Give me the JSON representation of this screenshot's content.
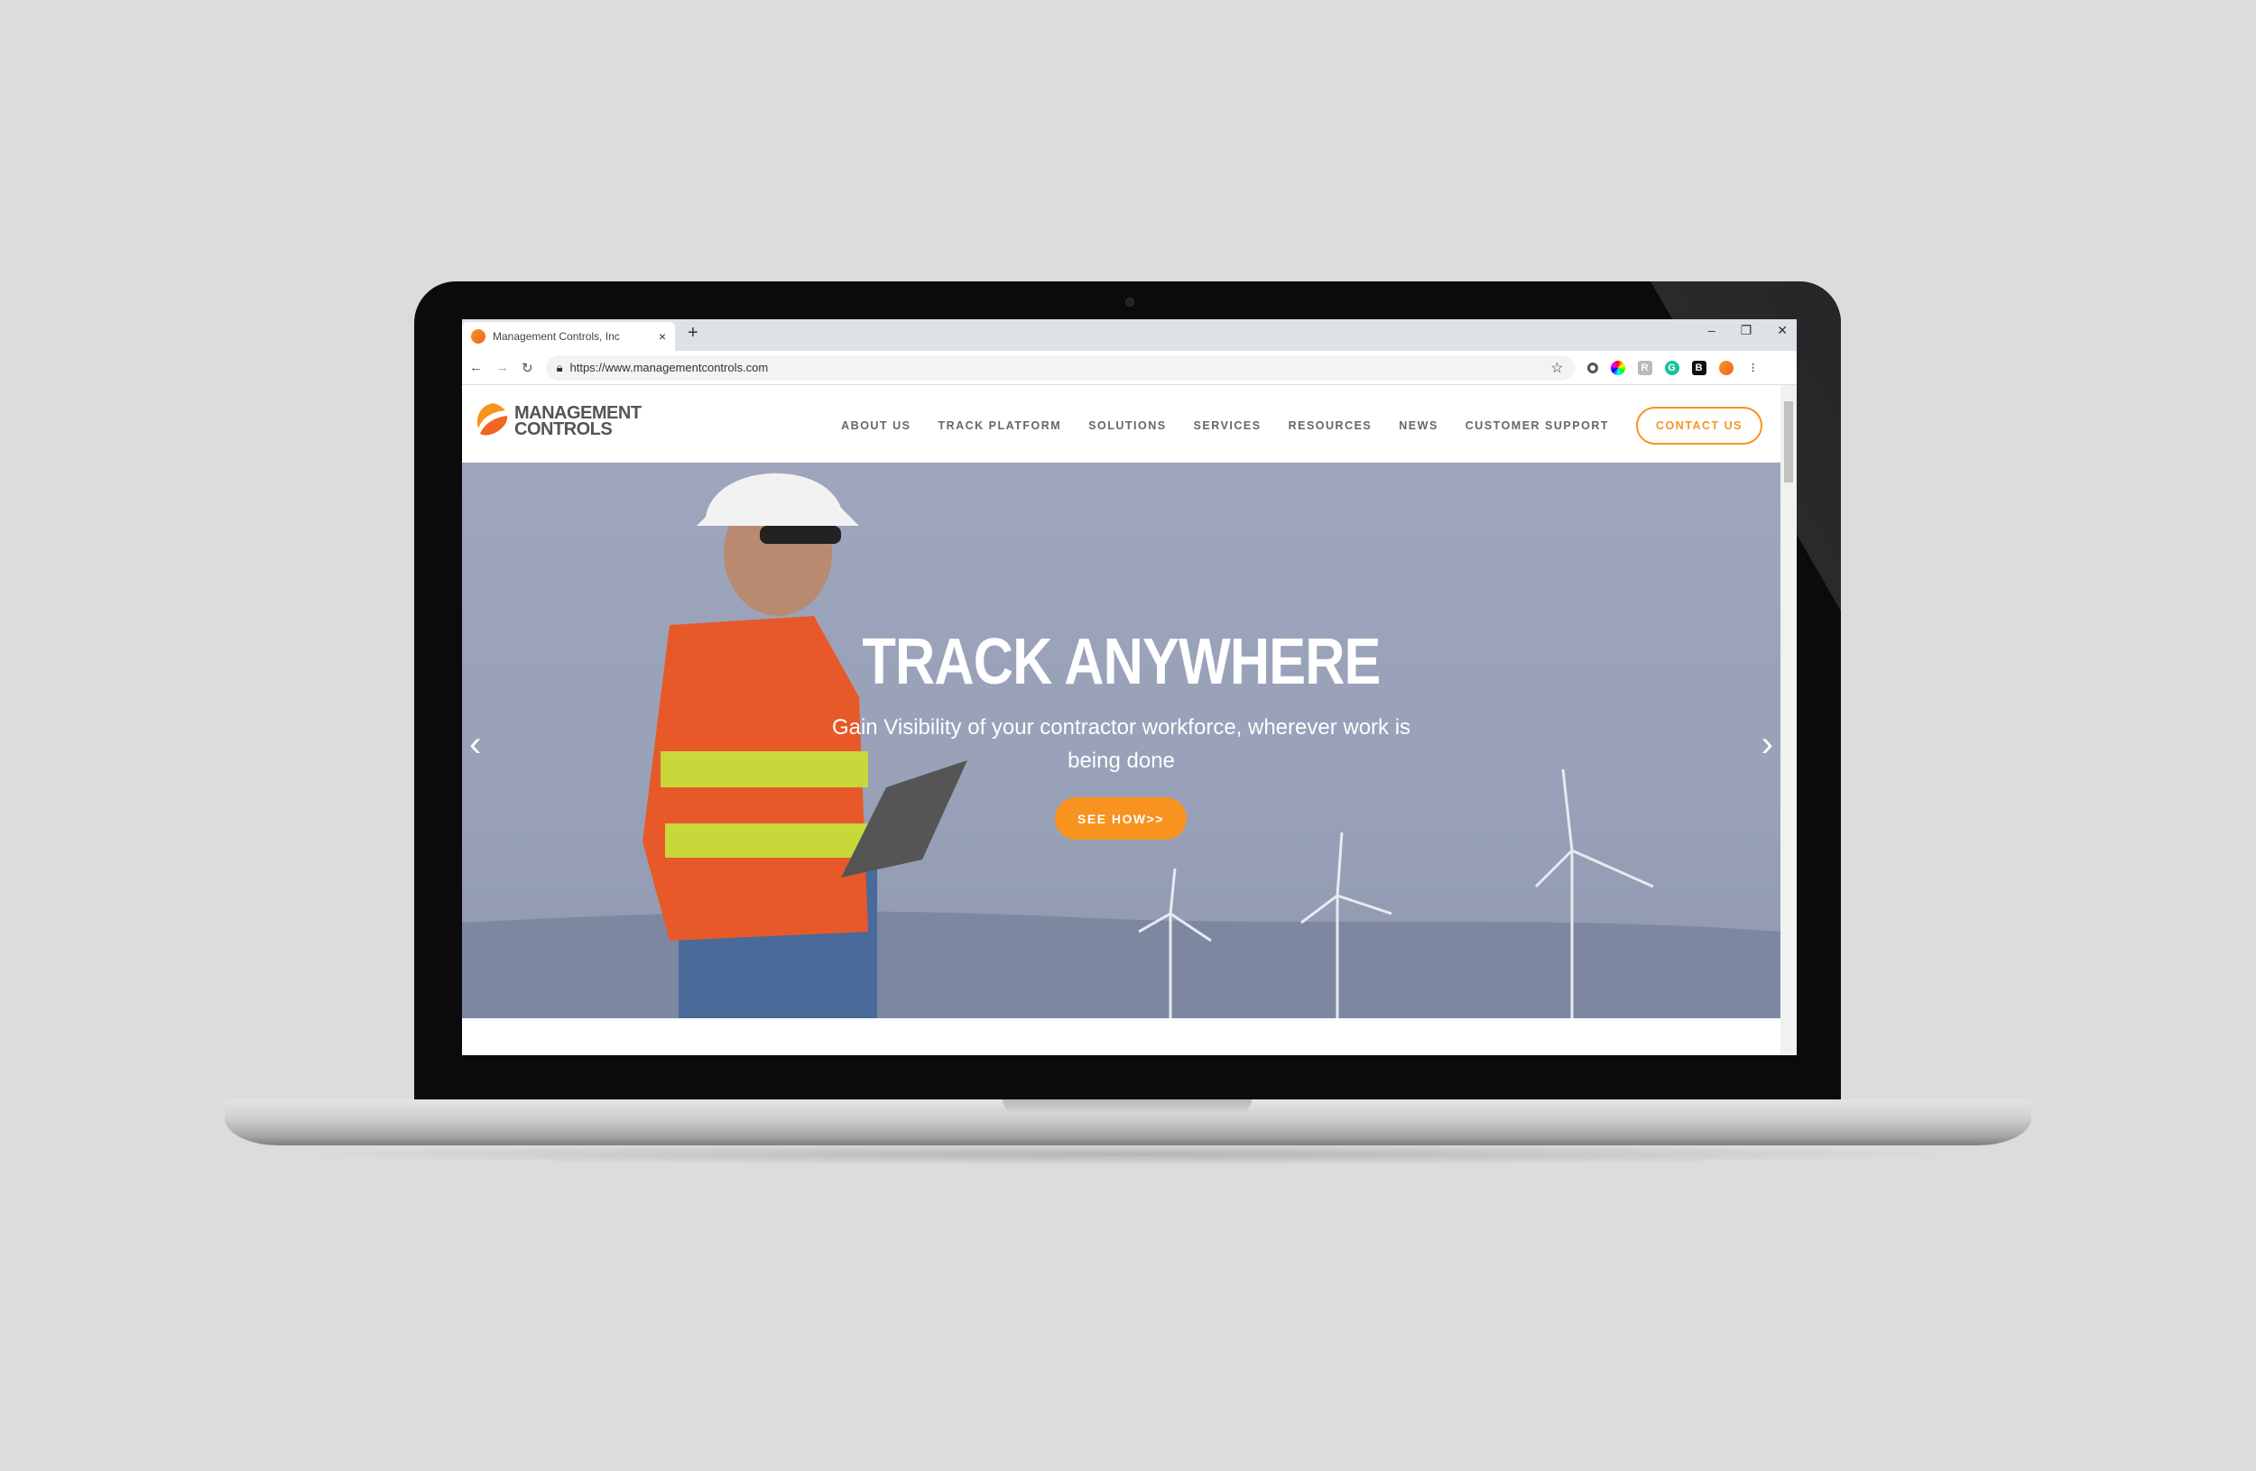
{
  "browser": {
    "tab_title": "Management Controls, Inc",
    "tab_close": "×",
    "new_tab": "+",
    "url": "https://www.managementcontrols.com",
    "window_controls": [
      "–",
      "❐",
      "✕"
    ]
  },
  "site": {
    "logo_line1": "MANAGEMENT",
    "logo_line2": "CONTROLS",
    "nav": [
      "ABOUT US",
      "TRACK PLATFORM",
      "SOLUTIONS",
      "SERVICES",
      "RESOURCES",
      "NEWS",
      "CUSTOMER SUPPORT"
    ],
    "contact_label": "CONTACT US"
  },
  "hero": {
    "title": "TRACK ANYWHERE",
    "subtitle": "Gain Visibility of your contractor workforce, wherever work is being done",
    "cta_label": "SEE HOW>>",
    "prev": "‹",
    "next": "›"
  },
  "colors": {
    "accent": "#f7931e",
    "nav_text": "#666666",
    "hero_overlay": "#9ea5bc"
  }
}
